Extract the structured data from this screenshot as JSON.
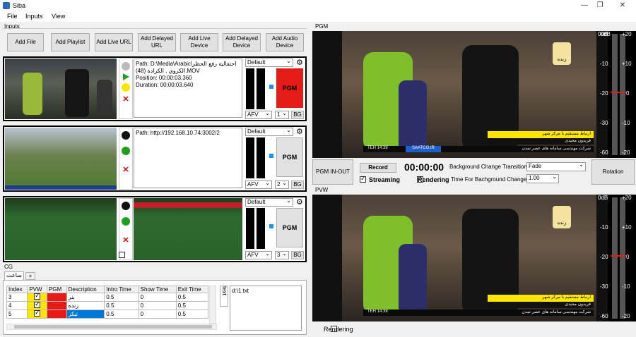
{
  "window": {
    "title": "Siba"
  },
  "menu": [
    "File",
    "Inputs",
    "View"
  ],
  "inputs_label": "Inputs",
  "pgm_label": "PGM",
  "pvw_label": "PVW",
  "cg_label": "CG",
  "toolbar": {
    "add_file": "Add File",
    "add_playlist": "Add Playlist",
    "add_live_url": "Add Live URL",
    "add_delayed_url": "Add Delayed URL",
    "add_live_device": "Add Live Device",
    "add_delayed_device": "Add Delayed Device",
    "add_audio_device": "Add Audio Device"
  },
  "inputs": [
    {
      "path": "Path: D:\\Media\\Arabic\\احتفالية رفع الحظر",
      "path2": "الكروي , الكرادة (48).MOV",
      "position": "Position: 00:00:03.360",
      "duration": "Duration: 00:00:03.640",
      "preset": "Default",
      "afv": "AFV",
      "num": "1",
      "bg": "BG",
      "pgm": "PGM",
      "pgm_active": true
    },
    {
      "path": "Path: http://192.168.10.74:3002/2",
      "path2": "",
      "position": "",
      "duration": "",
      "preset": "Default",
      "afv": "AFV",
      "num": "2",
      "bg": "BG",
      "pgm": "PGM",
      "pgm_active": false
    },
    {
      "path": "",
      "path2": "",
      "position": "",
      "duration": "",
      "preset": "Default",
      "afv": "AFV",
      "num": "3",
      "bg": "BG",
      "pgm": "PGM",
      "pgm_active": false
    }
  ],
  "cg": {
    "tab": "ساعت",
    "tab_add": "+",
    "columns": [
      "Index",
      "PVW",
      "PGM",
      "Description",
      "Intro Time",
      "Show Time",
      "Exit Time"
    ],
    "rows": [
      {
        "index": "3",
        "pvw": true,
        "desc": "بنر",
        "intro": "0.5",
        "show": "0",
        "exit": "0.5"
      },
      {
        "index": "4",
        "pvw": true,
        "desc": "زنده",
        "intro": "0.5",
        "show": "0",
        "exit": "0.5"
      },
      {
        "index": "5",
        "pvw": true,
        "desc": "تیکر",
        "intro": "0.5",
        "show": "0",
        "exit": "0.5"
      }
    ],
    "text_tab": "text",
    "text_value": "d:\\1.txt"
  },
  "controls": {
    "pgm_in_out": "PGM IN-OUT",
    "record": "Record",
    "timecode": "00:00:00",
    "streaming": "Streaming",
    "rendering": "Rendering",
    "bg_transition_label": "Background Change Transition:",
    "bg_transition_value": "Fade",
    "bg_time_label": "Time For Bachground Change:",
    "bg_time_value": "1.00",
    "rotation": "Rotation",
    "pvw_rendering": "Rendering"
  },
  "meter_scale": [
    "0dB",
    "-10",
    "-20",
    "-30",
    "-60"
  ],
  "meter_scale_right": [
    "+20",
    "+10",
    "0",
    "-10",
    "-20"
  ],
  "overlay": {
    "live_badge": "زنده",
    "lower_text1": "ارتباط مستقیم با مرکز شهر",
    "lower_text2": "فریدون مجیدی",
    "ticker": "شرکت مهندسی سامانه های عصر تمدن",
    "site": "SAATCO.IR",
    "clock": "TEH 14:38"
  },
  "colors": {
    "pgm_active": "#e41b17",
    "selection": "#0078d7"
  }
}
